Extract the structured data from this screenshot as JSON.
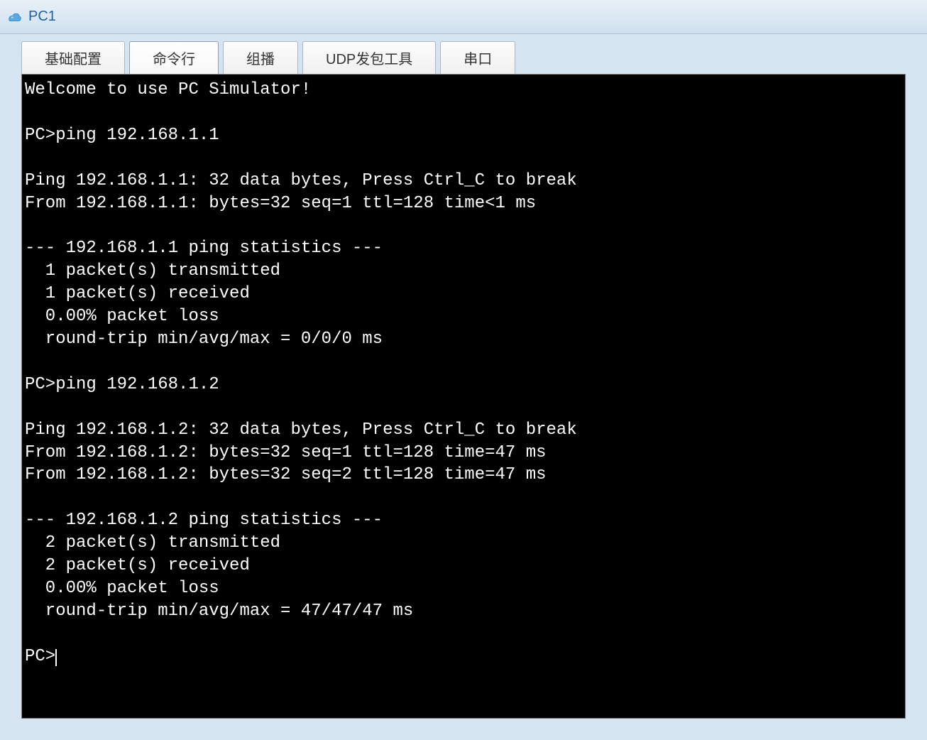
{
  "title_bar": {
    "window_title": "PC1"
  },
  "tabs": [
    {
      "label": "基础配置",
      "active": false
    },
    {
      "label": "命令行",
      "active": true
    },
    {
      "label": "组播",
      "active": false
    },
    {
      "label": "UDP发包工具",
      "active": false
    },
    {
      "label": "串口",
      "active": false
    }
  ],
  "terminal": {
    "lines": [
      "Welcome to use PC Simulator!",
      "",
      "PC>ping 192.168.1.1",
      "",
      "Ping 192.168.1.1: 32 data bytes, Press Ctrl_C to break",
      "From 192.168.1.1: bytes=32 seq=1 ttl=128 time<1 ms",
      "",
      "--- 192.168.1.1 ping statistics ---",
      "  1 packet(s) transmitted",
      "  1 packet(s) received",
      "  0.00% packet loss",
      "  round-trip min/avg/max = 0/0/0 ms",
      "",
      "PC>ping 192.168.1.2",
      "",
      "Ping 192.168.1.2: 32 data bytes, Press Ctrl_C to break",
      "From 192.168.1.2: bytes=32 seq=1 ttl=128 time=47 ms",
      "From 192.168.1.2: bytes=32 seq=2 ttl=128 time=47 ms",
      "",
      "--- 192.168.1.2 ping statistics ---",
      "  2 packet(s) transmitted",
      "  2 packet(s) received",
      "  0.00% packet loss",
      "  round-trip min/avg/max = 47/47/47 ms",
      ""
    ],
    "prompt": "PC>"
  }
}
